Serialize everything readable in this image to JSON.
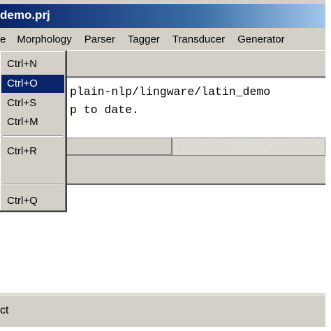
{
  "window": {
    "title": "demo.prj"
  },
  "menubar": {
    "items": [
      {
        "label": "e"
      },
      {
        "label": "Morphology"
      },
      {
        "label": "Parser"
      },
      {
        "label": "Tagger"
      },
      {
        "label": "Transducer"
      },
      {
        "label": "Generator"
      }
    ]
  },
  "output": {
    "line1": "plain-nlp/lingware/latin_demo",
    "line2": "p to date."
  },
  "dropdown": {
    "items": [
      {
        "shortcut": "Ctrl+N"
      },
      {
        "shortcut": "Ctrl+O",
        "selected": true
      },
      {
        "shortcut": "Ctrl+S"
      },
      {
        "shortcut": "Ctrl+M"
      },
      {
        "shortcut": "Ctrl+R"
      },
      {
        "shortcut": "Ctrl+Q"
      }
    ]
  },
  "progress": {
    "fraction": 0.53
  },
  "statusbar": {
    "text": "ct"
  },
  "colors": {
    "selection": "#0a246a",
    "title_gradient_start": "#0a246a",
    "title_gradient_end": "#a6caf0",
    "face": "#d4d0c8"
  }
}
